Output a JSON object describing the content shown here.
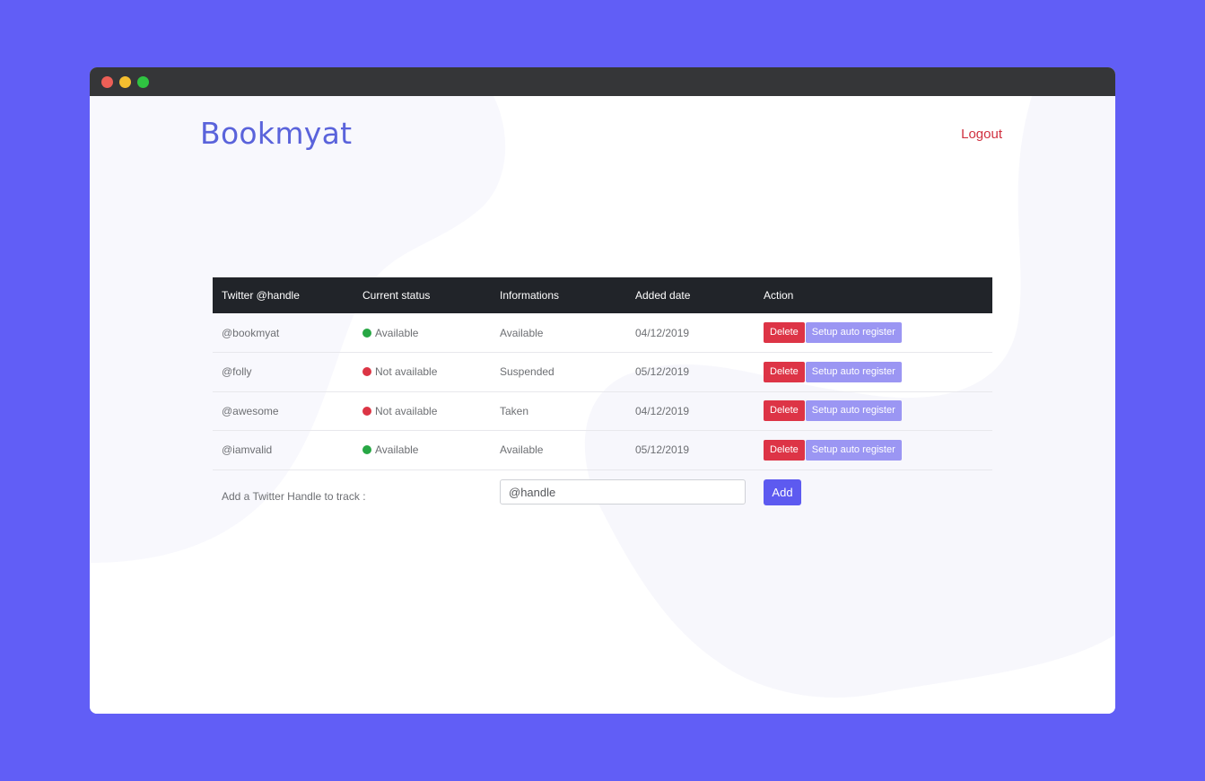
{
  "app": {
    "logo": "Bookmyat",
    "logout_label": "Logout"
  },
  "colors": {
    "page_background": "#615ef6",
    "brand": "#5a63db",
    "available": "#27a744",
    "not_available": "#dc3545",
    "delete_button": "#dd3446",
    "setup_button": "#9b96f3",
    "add_button": "#5d5af0"
  },
  "table": {
    "headers": [
      "Twitter @handle",
      "Current status",
      "Informations",
      "Added date",
      "Action"
    ],
    "rows": [
      {
        "handle": "@bookmyat",
        "status": "Available",
        "status_color": "#27a744",
        "info": "Available",
        "date": "04/12/2019",
        "delete_label": "Delete",
        "setup_label": "Setup auto register"
      },
      {
        "handle": "@folly",
        "status": "Not available",
        "status_color": "#dc3545",
        "info": "Suspended",
        "date": "05/12/2019",
        "delete_label": "Delete",
        "setup_label": "Setup auto register"
      },
      {
        "handle": "@awesome",
        "status": "Not available",
        "status_color": "#dc3545",
        "info": "Taken",
        "date": "04/12/2019",
        "delete_label": "Delete",
        "setup_label": "Setup auto register"
      },
      {
        "handle": "@iamvalid",
        "status": "Available",
        "status_color": "#27a744",
        "info": "Available",
        "date": "05/12/2019",
        "delete_label": "Delete",
        "setup_label": "Setup auto register"
      }
    ]
  },
  "add_form": {
    "label": "Add a Twitter Handle to track :",
    "placeholder": "@handle",
    "value": "",
    "button_label": "Add"
  }
}
